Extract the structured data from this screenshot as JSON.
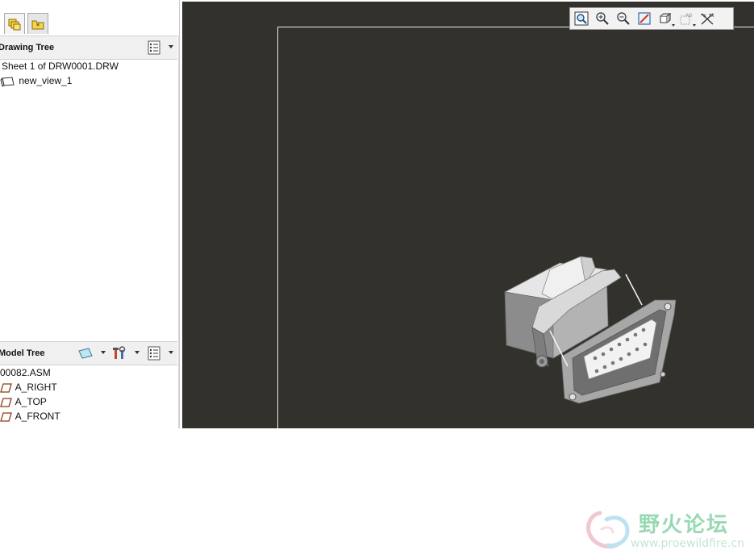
{
  "drawing_tree": {
    "title": "Drawing Tree",
    "items": [
      {
        "label": "Sheet 1 of DRW0001.DRW"
      },
      {
        "label": "new_view_1"
      }
    ]
  },
  "model_tree": {
    "title": "Model Tree",
    "items": [
      {
        "label": "00082.ASM"
      },
      {
        "label": "A_RIGHT"
      },
      {
        "label": "A_TOP"
      },
      {
        "label": "A_FRONT"
      }
    ]
  },
  "watermark": {
    "title": "野火论坛",
    "url": "www.proewildfire.cn"
  },
  "colors": {
    "viewport_bg": "#33312c",
    "sheet_border": "#eaeaea",
    "panel_bg": "#ffffff",
    "watermark_green": "#97d9b2"
  },
  "icons": {
    "tab1": "layers-folder-icon",
    "tab2": "favorites-folder-icon",
    "toolbar": [
      "refit-icon",
      "zoom-in-icon",
      "zoom-out-icon",
      "repaint-icon",
      "orient-icon",
      "annotation-display-icon",
      "datum-display-icon"
    ]
  }
}
